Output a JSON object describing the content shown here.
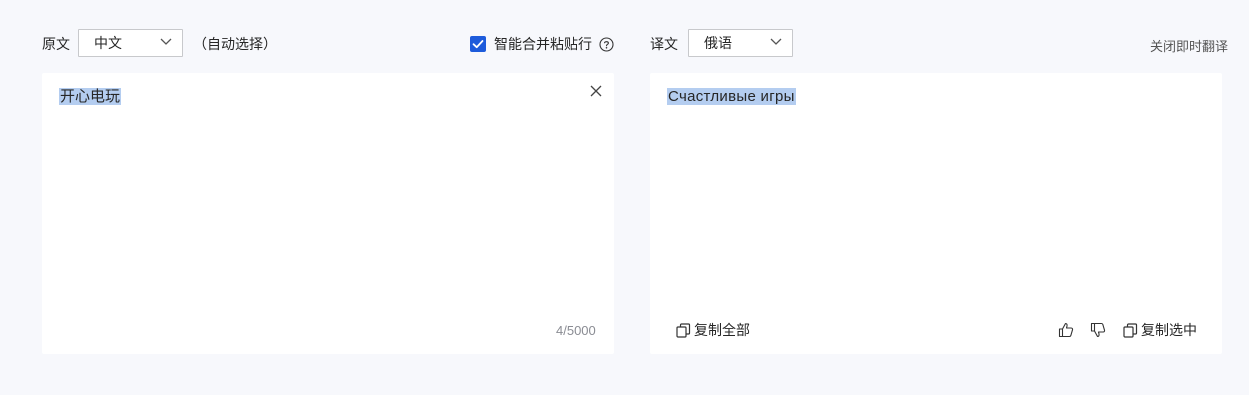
{
  "source": {
    "label": "原文",
    "language": "中文",
    "auto_select": "（自动选择）",
    "text": "开心电玩",
    "char_count": "4/5000"
  },
  "options": {
    "smart_merge_label": "智能合并粘贴行",
    "smart_merge_checked": true
  },
  "target": {
    "label": "译文",
    "language": "俄语",
    "close_instant": "关闭即时翻译",
    "text": "Счастливые игры",
    "copy_all": "复制全部",
    "copy_selected": "复制选中"
  },
  "colors": {
    "accent": "#1d5bdb",
    "background": "#f7f8fc",
    "selection": "#b4cdf0"
  },
  "icons": [
    "chevron-down-icon",
    "checkbox-check-icon",
    "help-circle-icon",
    "close-icon",
    "copy-icon",
    "thumbs-up-icon",
    "thumbs-down-icon"
  ]
}
